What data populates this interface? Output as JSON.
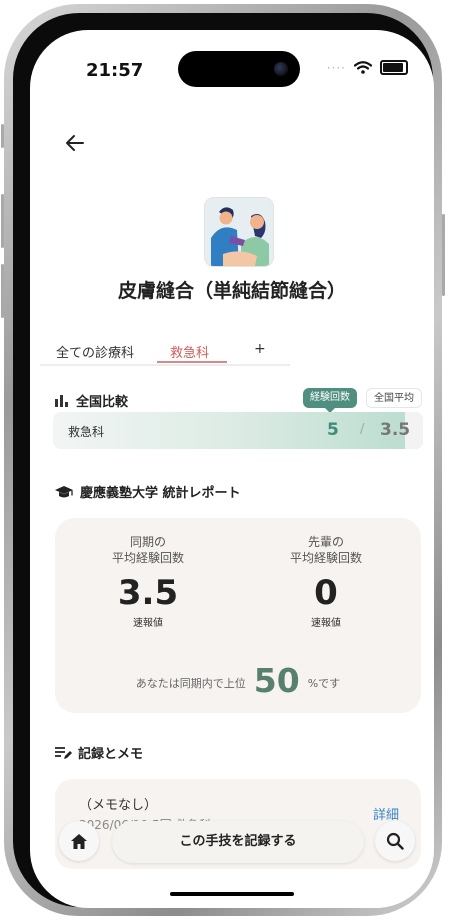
{
  "status_bar": {
    "time": "21:57",
    "signal_dots": "····"
  },
  "header": {
    "back_icon": "arrow-left-icon"
  },
  "procedure": {
    "title": "皮膚縫合（単純結節縫合）",
    "thumbnail_icon": "surgeons-suturing-illustration"
  },
  "tabs": [
    {
      "label": "全ての診療科",
      "active": false
    },
    {
      "label": "救急科",
      "active": true
    },
    {
      "label": "+",
      "active": false
    }
  ],
  "national": {
    "heading": "全国比較",
    "pill_experience": "経験回数",
    "pill_average": "全国平均",
    "row_label": "救急科",
    "experience_count": "5",
    "separator": "/",
    "national_average": "3.5",
    "bar_fill_fraction": 0.95
  },
  "university": {
    "heading": "慶應義塾大学 統計レポート",
    "cohort_label_line1": "同期の",
    "cohort_label_line2": "平均経験回数",
    "cohort_value": "3.5",
    "cohort_sub": "速報値",
    "senior_label_line1": "先輩の",
    "senior_label_line2": "平均経験回数",
    "senior_value": "0",
    "senior_sub": "速報値",
    "rank_prefix": "あなたは同期内で上位",
    "rank_value": "50",
    "rank_suffix": "%です"
  },
  "records": {
    "heading": "記録とメモ",
    "memo_title": "（メモなし）",
    "memo_meta": "2026/06/10 5回 救急科",
    "detail_link": "詳細"
  },
  "bottom_bar": {
    "record_button": "この手技を記録する",
    "home_icon": "home-icon",
    "search_icon": "search-icon"
  },
  "colors": {
    "accent_green": "#4f8f7f",
    "tab_active": "#d15b5b",
    "link_blue": "#3b84c9",
    "card_bg": "#f6f3f0"
  }
}
